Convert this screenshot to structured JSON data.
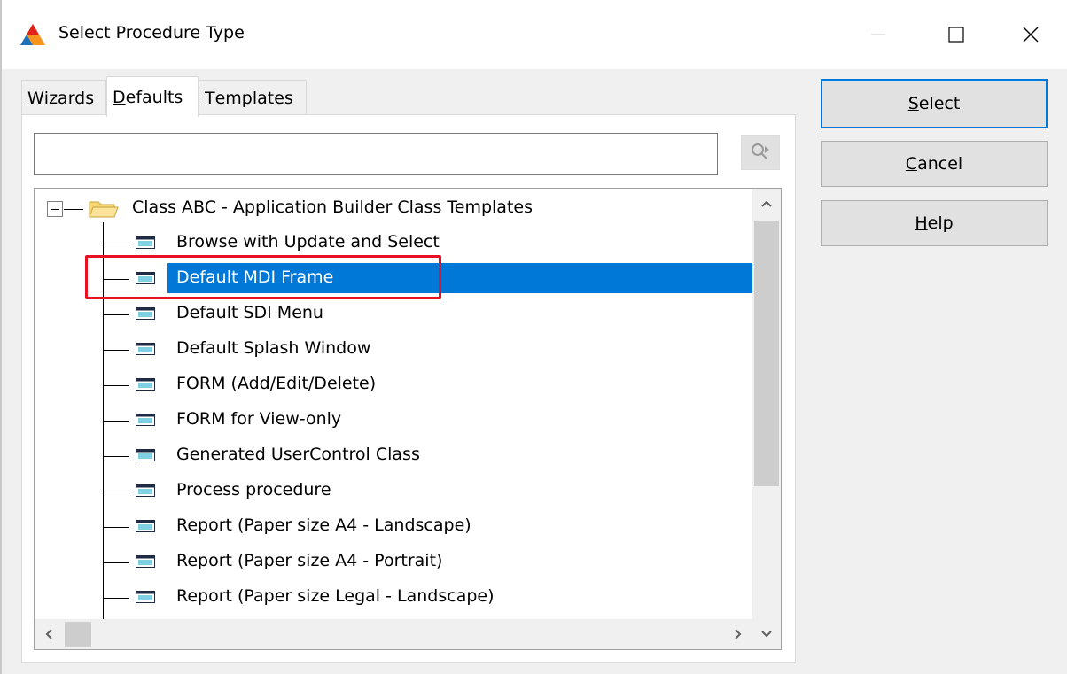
{
  "window": {
    "title": "Select Procedure Type",
    "minimize_glyph": "—",
    "maximize_glyph": "☐",
    "close_glyph": "✕"
  },
  "tabs": [
    {
      "label_prefix": "",
      "mnemonic": "W",
      "label_rest": "izards",
      "active": false
    },
    {
      "label_prefix": "",
      "mnemonic": "D",
      "label_rest": "efaults",
      "active": true
    },
    {
      "label_prefix": "",
      "mnemonic": "T",
      "label_rest": "emplates",
      "active": false
    }
  ],
  "search": {
    "value": "",
    "placeholder": ""
  },
  "tree": {
    "root_label": "Class ABC - Application Builder Class Templates",
    "items": [
      {
        "label": "Browse with Update and Select"
      },
      {
        "label": "Default MDI Frame",
        "selected": true
      },
      {
        "label": "Default SDI Menu"
      },
      {
        "label": "Default Splash Window"
      },
      {
        "label": "FORM (Add/Edit/Delete)"
      },
      {
        "label": "FORM for View-only"
      },
      {
        "label": "Generated UserControl Class"
      },
      {
        "label": "Process procedure"
      },
      {
        "label": "Report (Paper size A4 - Landscape)"
      },
      {
        "label": "Report (Paper size A4 - Portrait)"
      },
      {
        "label": "Report (Paper size Legal - Landscape)"
      }
    ]
  },
  "buttons": {
    "select": {
      "mnemonic": "S",
      "rest": "elect"
    },
    "cancel": {
      "mnemonic": "C",
      "rest": "ancel"
    },
    "help": {
      "mnemonic": "H",
      "rest": "elp"
    }
  },
  "colors": {
    "selection": "#0078d7",
    "annotation_box": "#e81123",
    "primary_border": "#0078d7"
  }
}
